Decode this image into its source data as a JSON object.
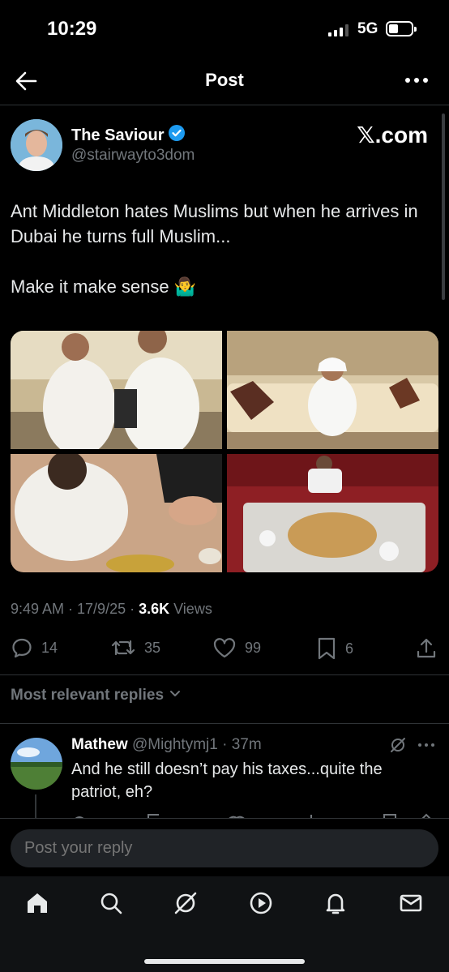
{
  "status": {
    "time": "10:29",
    "network": "5G"
  },
  "header": {
    "title": "Post"
  },
  "post": {
    "author_name": "The Saviour",
    "author_handle": "@stairwayto3dom",
    "watermark": "𝕏.com",
    "text_line1": "Ant Middleton hates Muslims but when he arrives in Dubai he turns full Muslim...",
    "text_line2": "Make it make sense 🤷‍♂️",
    "time_date": "9:49 AM · 17/9/25 · ",
    "views_count": "3.6K",
    "views_label": " Views",
    "stats": {
      "replies": "14",
      "reposts": "35",
      "likes": "99",
      "bookmarks": "6"
    }
  },
  "replies_section": {
    "label": "Most relevant replies"
  },
  "reply": {
    "name": "Mathew",
    "handle_time": " @Mightymj1 · 37m",
    "text": "And he still doesn’t pay his taxes...quite the patriot, eh?"
  },
  "compose": {
    "placeholder": "Post your reply"
  },
  "colors": {
    "background": "#000000",
    "text": "#e7e9ea",
    "muted": "#71767b",
    "verified": "#1d9bf0",
    "divider": "#2f3336"
  }
}
